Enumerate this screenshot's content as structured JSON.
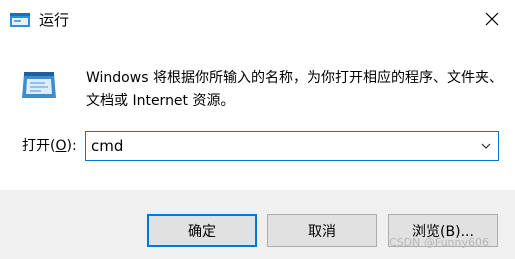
{
  "window": {
    "title": "运行",
    "app_icon": "run-dialog-icon",
    "close_icon": "close-icon"
  },
  "content": {
    "run_icon": "run-program-icon",
    "description": "Windows 将根据你所输入的名称，为你打开相应的程序、文件夹、文档或 Internet 资源。",
    "open_label_prefix": "打开(",
    "open_label_accel": "O",
    "open_label_suffix": "):",
    "command_value": "cmd",
    "dropdown_icon": "chevron-down-icon"
  },
  "buttons": {
    "ok_label": "确定",
    "cancel_label": "取消",
    "browse_label": "浏览(B)..."
  },
  "watermark": "CSDN @Funny606",
  "colors": {
    "accent": "#0078d7",
    "content_bg": "#ffffff",
    "footer_bg": "#f0f0f0",
    "button_bg": "#e1e1e1"
  }
}
